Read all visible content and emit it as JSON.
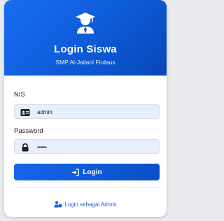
{
  "header": {
    "icon": "graduate-icon",
    "title": "Login Siswa",
    "subtitle": "SMP Al-Jailani Firdaus"
  },
  "form": {
    "nis": {
      "label": "NIS",
      "icon": "id-card-icon",
      "value": "admin"
    },
    "password": {
      "label": "Password",
      "icon": "lock-icon",
      "value": "•••••"
    },
    "submit": {
      "icon": "sign-in-icon",
      "label": "Login"
    }
  },
  "footer": {
    "icon": "user-shield-icon",
    "admin_link": "Login sebagai Admin"
  },
  "colors": {
    "primary": "#0d5ad6",
    "field_bg": "#e8eefb",
    "link": "#1a5fd6"
  }
}
